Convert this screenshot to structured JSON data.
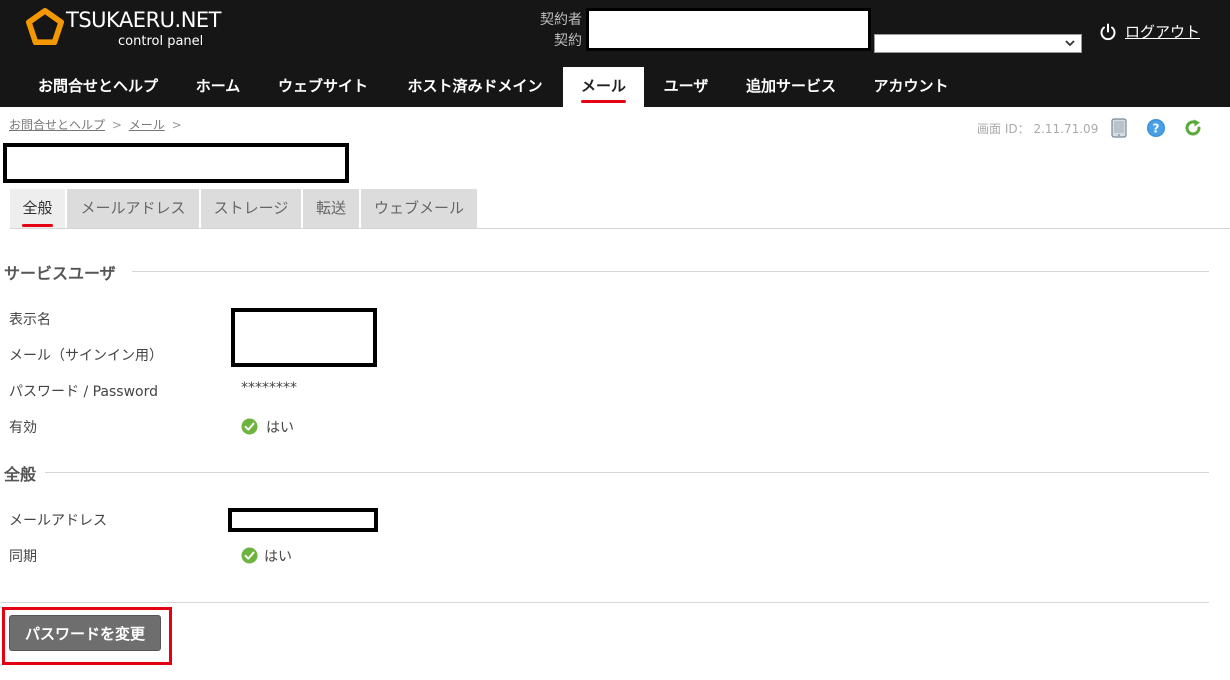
{
  "app": {
    "logo_title": "TSUKAERU.NET",
    "logo_subtitle": "control panel"
  },
  "header": {
    "contract_holder_label": "契約者",
    "contract_label": "契約",
    "logout_label": "ログアウト"
  },
  "nav": {
    "items": [
      {
        "label": "お問合せとヘルプ"
      },
      {
        "label": "ホーム"
      },
      {
        "label": "ウェブサイト"
      },
      {
        "label": "ホスト済みドメイン"
      },
      {
        "label": "メール"
      },
      {
        "label": "ユーザ"
      },
      {
        "label": "追加サービス"
      },
      {
        "label": "アカウント"
      }
    ],
    "active": "メール"
  },
  "breadcrumb": {
    "items": [
      "お問合せとヘルプ",
      "メール"
    ],
    "separator": ">"
  },
  "screen_id": {
    "label": "画面 ID：",
    "value": "2.11.71.09"
  },
  "tabs": {
    "items": [
      {
        "label": "全般"
      },
      {
        "label": "メールアドレス"
      },
      {
        "label": "ストレージ"
      },
      {
        "label": "転送"
      },
      {
        "label": "ウェブメール"
      }
    ],
    "active": "全般"
  },
  "service_user": {
    "title": "サービスユーザ",
    "display_name_label": "表示名",
    "email_signin_label": "メール（サインイン用）",
    "password_label": "パスワード / Password",
    "password_value": "********",
    "enabled_label": "有効",
    "enabled_value": "はい"
  },
  "general": {
    "title": "全般",
    "email_address_label": "メールアドレス",
    "sync_label": "同期",
    "sync_value": "はい"
  },
  "actions": {
    "change_password_label": "パスワードを変更"
  },
  "colors": {
    "header_bg": "#161616",
    "accent_red": "#e50012",
    "logo_orange": "#f39800",
    "check_green": "#6cb33f",
    "button_gray": "#6e6e6e"
  }
}
